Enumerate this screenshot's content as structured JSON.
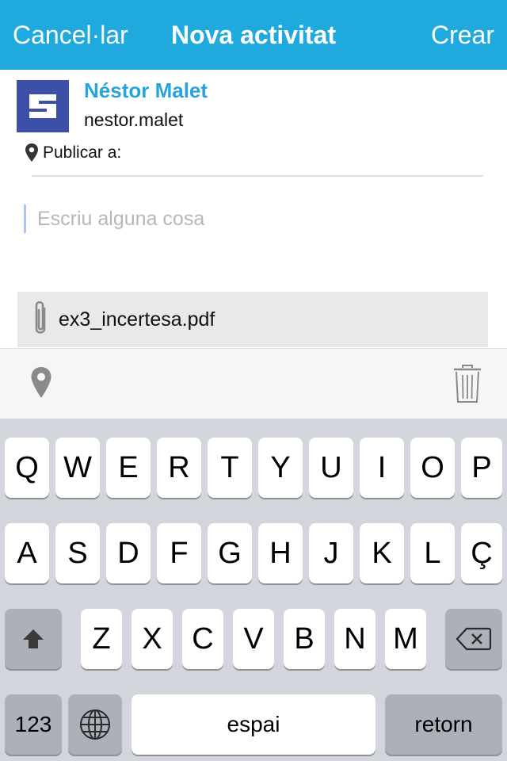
{
  "header": {
    "cancel_label": "Cancel·lar",
    "title": "Nova activitat",
    "create_label": "Crear",
    "background": "#1fa9dd"
  },
  "author": {
    "name": "Néstor Malet",
    "handle": "nestor.malet",
    "avatar_color": "#3d50a8",
    "name_color": "#27a4de"
  },
  "publish": {
    "icon": "location-pin-icon",
    "label": "Publicar a:"
  },
  "compose": {
    "placeholder": "Escriu alguna cosa",
    "value": ""
  },
  "attachment": {
    "icon": "paperclip-icon",
    "filename": "ex3_incertesa.pdf"
  },
  "toolbar": {
    "location_icon": "location-pin-icon",
    "delete_icon": "trash-icon"
  },
  "keyboard": {
    "row1": [
      "Q",
      "W",
      "E",
      "R",
      "T",
      "Y",
      "U",
      "I",
      "O",
      "P"
    ],
    "row2": [
      "A",
      "S",
      "D",
      "F",
      "G",
      "H",
      "J",
      "K",
      "L",
      "Ç"
    ],
    "row3": [
      "Z",
      "X",
      "C",
      "V",
      "B",
      "N",
      "M"
    ],
    "shift_icon": "shift-arrow-icon",
    "backspace_icon": "backspace-icon",
    "numbers_label": "123",
    "globe_icon": "globe-icon",
    "space_label": "espai",
    "return_label": "retorn"
  }
}
